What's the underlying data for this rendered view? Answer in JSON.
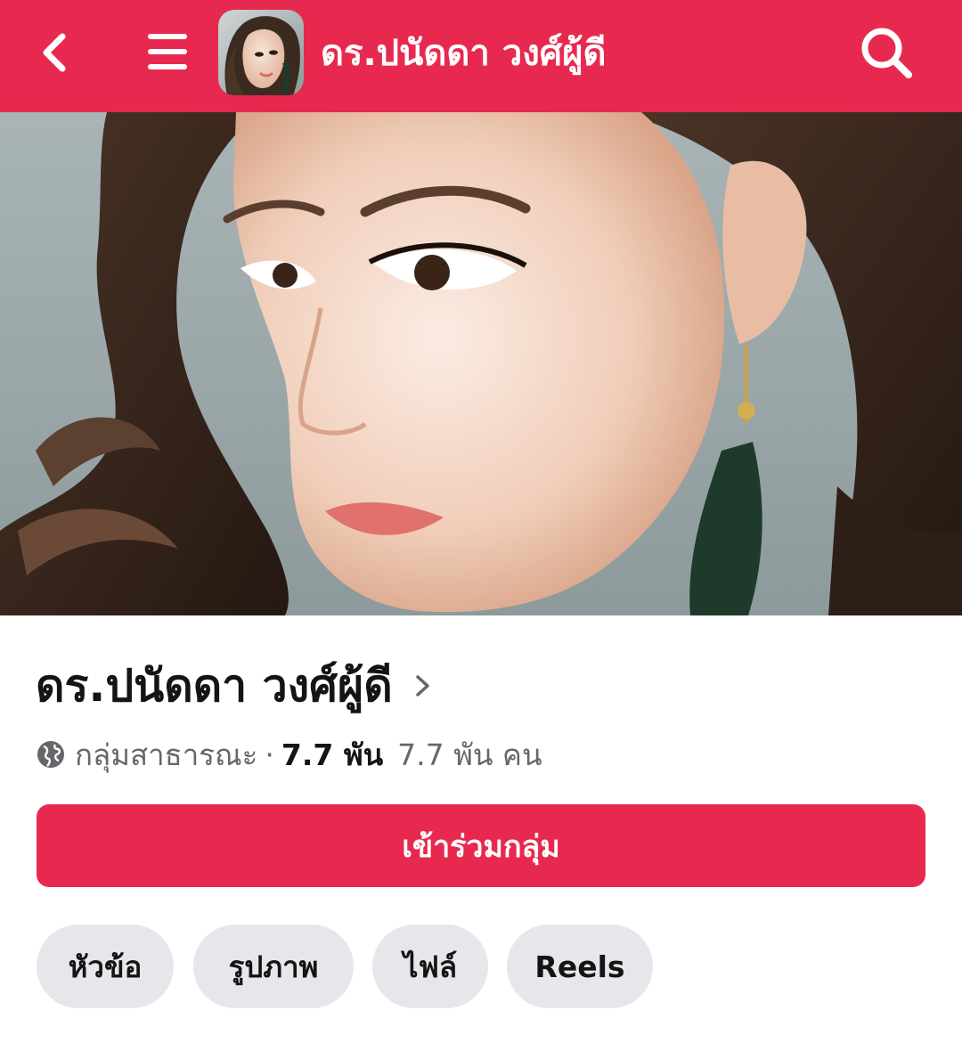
{
  "header": {
    "title": "ดร.ปนัดดา วงศ์ผู้ดี",
    "back_icon": "chevron-left-icon",
    "menu_icon": "hamburger-menu-icon",
    "search_icon": "search-icon"
  },
  "group": {
    "name": "ดร.ปนัดดา วงศ์ผู้ดี",
    "privacy": "กลุ่มสาธารณะ",
    "separator": "·",
    "members_bold": "7.7 พัน",
    "members_text": "7.7 พัน คน"
  },
  "join_button": {
    "label": "เข้าร่วมกลุ่ม"
  },
  "tabs": [
    {
      "label": "หัวข้อ"
    },
    {
      "label": "รูปภาพ"
    },
    {
      "label": "ไฟล์"
    },
    {
      "label": "Reels"
    }
  ],
  "colors": {
    "brand": "#e8294f",
    "chip_bg": "#e6e7eb",
    "text_primary": "#141414",
    "text_secondary": "#65676b"
  }
}
